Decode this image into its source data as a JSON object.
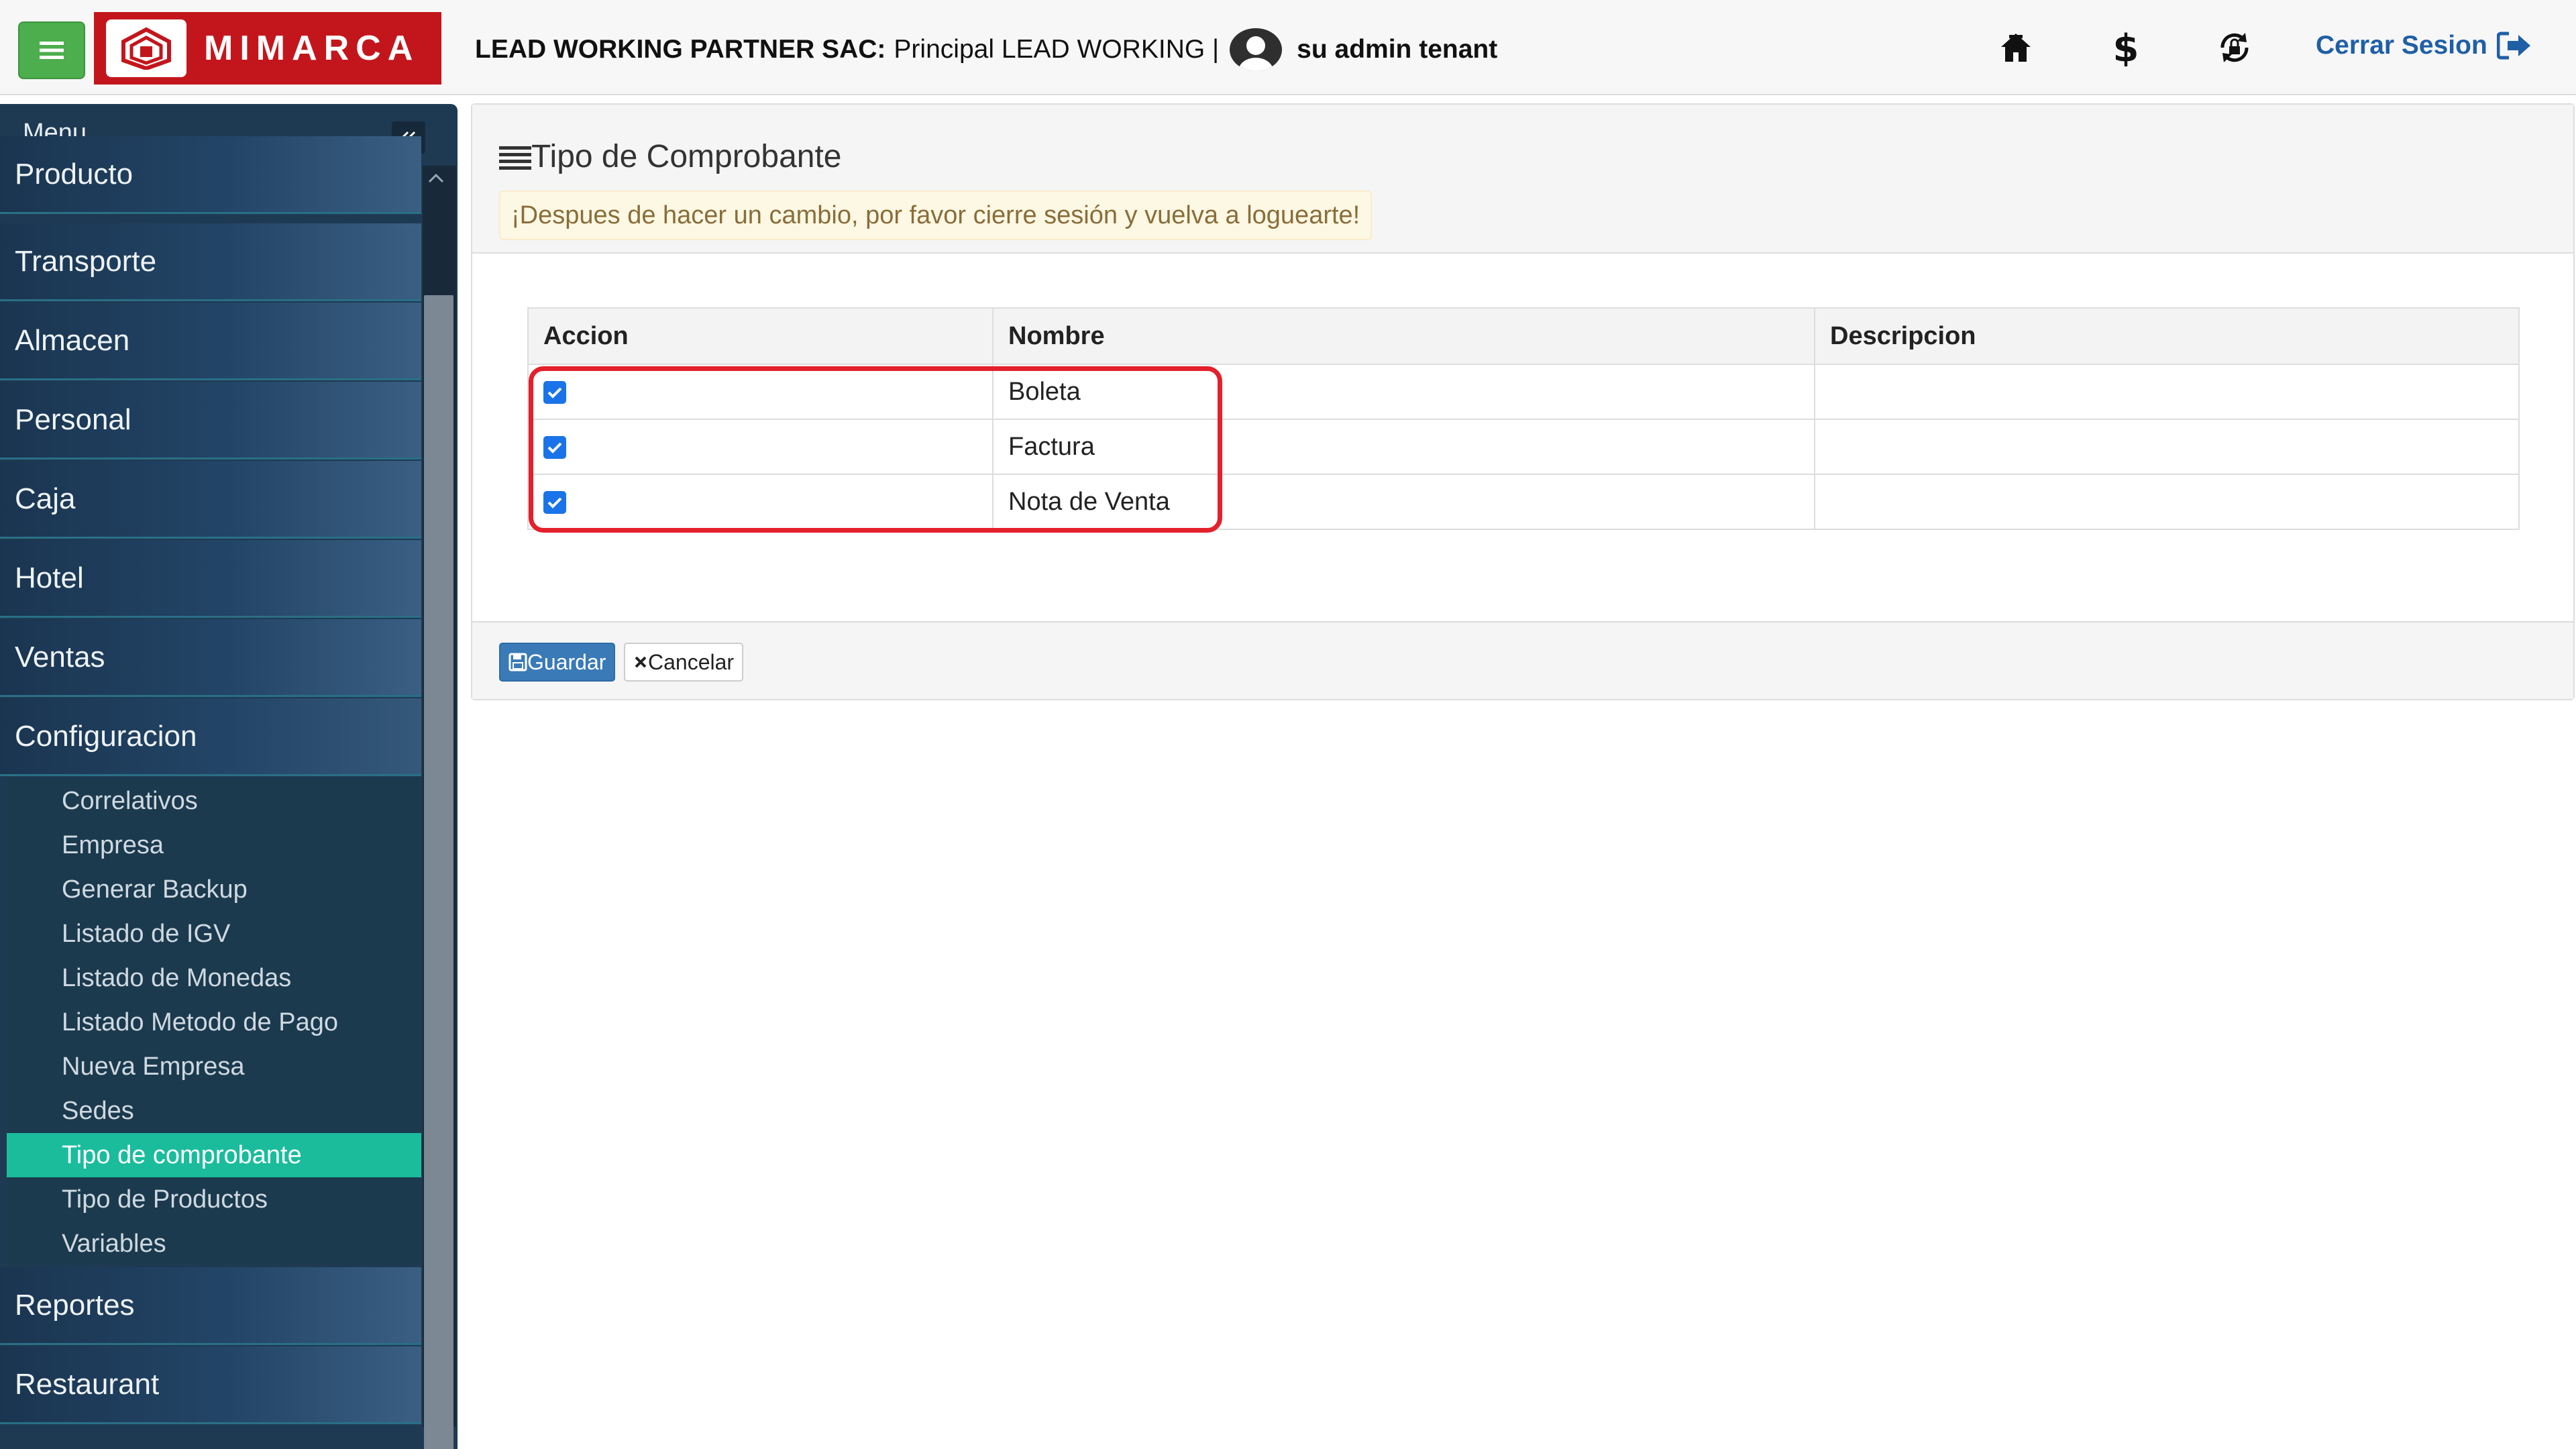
{
  "header": {
    "brand": "MIMARCA",
    "company": "LEAD WORKING PARTNER SAC:",
    "sede": "Principal LEAD WORKING |",
    "user": "su admin tenant",
    "logout_label": "Cerrar Sesion",
    "icons": [
      "home-icon",
      "dollar-icon",
      "lock-cycle-icon",
      "logout-icon"
    ]
  },
  "sidebar": {
    "title": "Menu",
    "sections_top": [
      "Producto",
      "Transporte",
      "Almacen",
      "Personal",
      "Caja",
      "Hotel",
      "Ventas",
      "Configuracion"
    ],
    "submenu": [
      "Correlativos",
      "Empresa",
      "Generar Backup",
      "Listado de IGV",
      "Listado de Monedas",
      "Listado Metodo de Pago",
      "Nueva Empresa",
      "Sedes",
      "Tipo de comprobante",
      "Tipo de Productos",
      "Variables"
    ],
    "active_item": "Tipo de comprobante",
    "sections_bottom": [
      "Reportes",
      "Restaurant"
    ]
  },
  "panel": {
    "title": "Tipo de Comprobante",
    "alert": "¡Despues de hacer un cambio, por favor cierre sesión y vuelva a loguearte!",
    "table": {
      "headers": [
        "Accion",
        "Nombre",
        "Descripcion"
      ],
      "rows": [
        {
          "checked": true,
          "nombre": "Boleta",
          "descripcion": ""
        },
        {
          "checked": true,
          "nombre": "Factura",
          "descripcion": ""
        },
        {
          "checked": true,
          "nombre": "Nota de Venta",
          "descripcion": ""
        }
      ]
    },
    "save_label": "Guardar",
    "cancel_label": "Cancelar"
  },
  "colors": {
    "brand_red": "#c3161c",
    "sidebar_bg": "#1e3a52",
    "active_teal": "#1abc9c",
    "primary_blue": "#3a7ab7",
    "highlight_red": "#e3202c",
    "logout_blue": "#1f5fa6"
  }
}
